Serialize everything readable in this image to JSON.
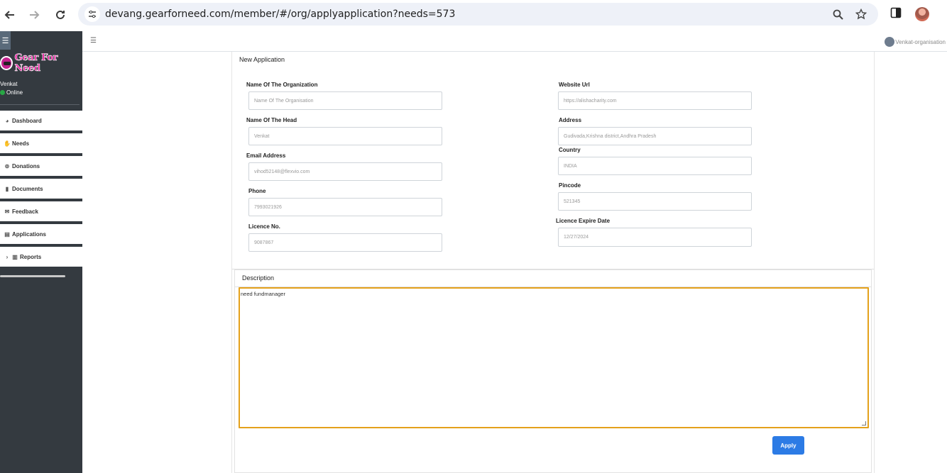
{
  "browser": {
    "url": "devang.gearforneed.com/member/#/org/applyapplication?needs=573"
  },
  "sidebar": {
    "logo_text": "Gear For Need",
    "user_name": "Venkat",
    "user_status": "Online",
    "items": [
      {
        "label": "Dashboard",
        "icon": "palette-icon"
      },
      {
        "label": "Needs",
        "icon": "hand-holding-icon"
      },
      {
        "label": "Donations",
        "icon": "donate-icon"
      },
      {
        "label": "Documents",
        "icon": "file-icon"
      },
      {
        "label": "Feedback",
        "icon": "envelope-icon"
      },
      {
        "label": "Applications",
        "icon": "file-text-icon"
      },
      {
        "label": "Reports",
        "icon": "copy-icon"
      }
    ]
  },
  "topnav": {
    "account_label": "Venkat-organisation"
  },
  "form": {
    "title": "New Application",
    "fields": {
      "org_name": {
        "label": "Name Of The Organization",
        "value": "Name Of The Organisation"
      },
      "head_name": {
        "label": "Name Of The Head",
        "value": "Venkat"
      },
      "email": {
        "label": "Email Address",
        "value": "vihod52148@flexvio.com"
      },
      "phone": {
        "label": "Phone",
        "value": "7993021926"
      },
      "licence": {
        "label": "Licence No.",
        "value": "9087867"
      },
      "website": {
        "label": "Website Url",
        "value": "https://alishacharity.com"
      },
      "address": {
        "label": "Address",
        "value": "Gudivada,Krishna district,Andhra Pradesh"
      },
      "country": {
        "label": "Country",
        "value": "INDIA"
      },
      "pincode": {
        "label": "Pincode",
        "value": "521345"
      },
      "expiry": {
        "label": "Licence Expire Date",
        "value": "12/27/2024"
      }
    },
    "description_label": "Description",
    "description_value": "need fundmanager",
    "apply_label": "Apply"
  },
  "colors": {
    "sidebar_bg": "#343a40",
    "accent": "#2c7be5",
    "focus_border": "#e4a11b",
    "online": "#28a745",
    "logo": "#e9149b"
  }
}
